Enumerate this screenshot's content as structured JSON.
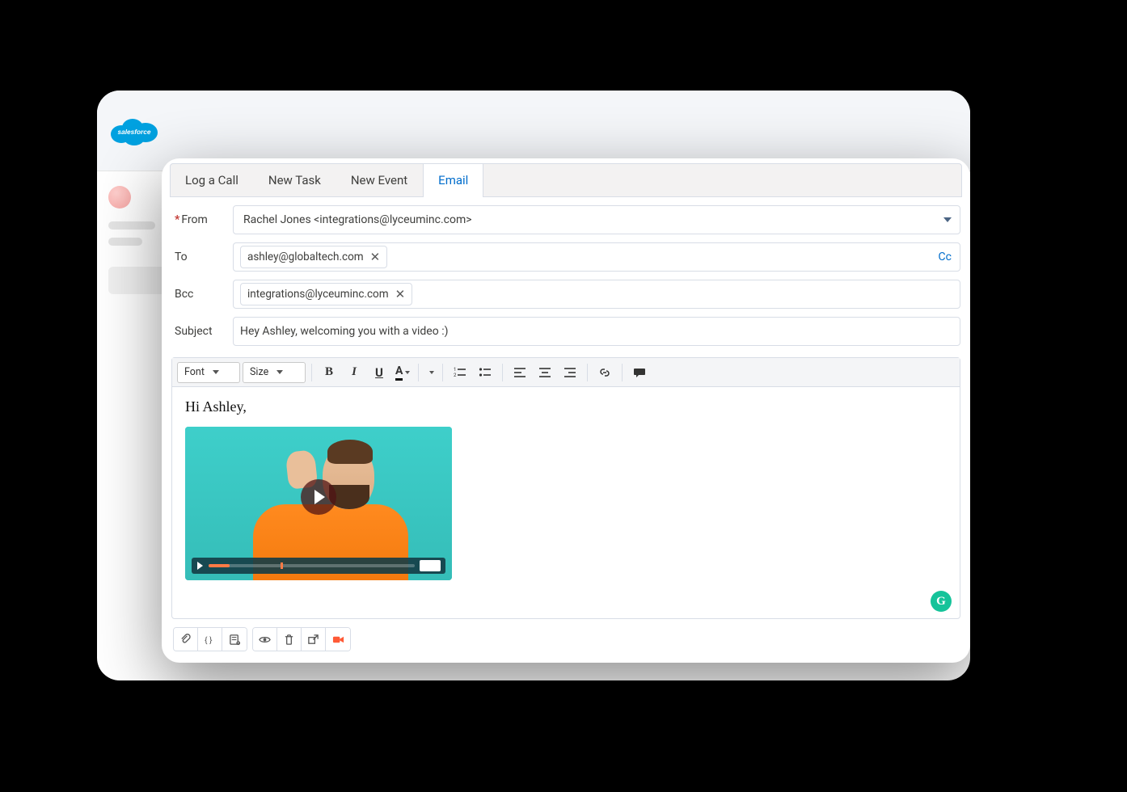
{
  "back": {
    "brand": "salesforce"
  },
  "tabs": {
    "items": [
      {
        "label": "Log a Call"
      },
      {
        "label": "New Task"
      },
      {
        "label": "New Event"
      },
      {
        "label": "Email"
      }
    ],
    "active_index": 3
  },
  "fields": {
    "from_label": "From",
    "from_value": "Rachel Jones <integrations@lyceuminc.com>",
    "to_label": "To",
    "to_chips": [
      "ashley@globaltech.com"
    ],
    "cc_label": "Cc",
    "bcc_label": "Bcc",
    "bcc_chips": [
      "integrations@lyceuminc.com"
    ],
    "subject_label": "Subject",
    "subject_value": "Hey Ashley, welcoming you with a video :)"
  },
  "toolbar": {
    "font_label": "Font",
    "size_label": "Size"
  },
  "body": {
    "greeting": "Hi Ashley,"
  },
  "grammarly": {
    "glyph": "G"
  }
}
